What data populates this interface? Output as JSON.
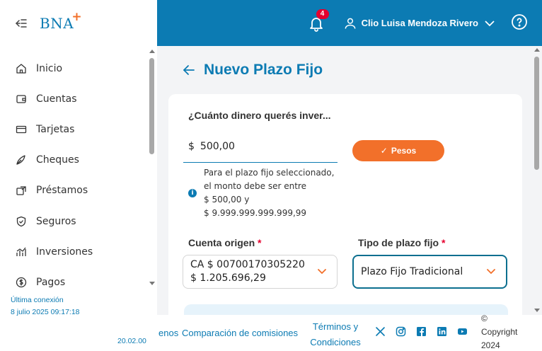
{
  "header": {
    "notifications_count": "4",
    "user_name": "Clio Luisa Mendoza Rivero"
  },
  "sidebar": {
    "logo_text": "BNA",
    "logo_plus": "+",
    "items": [
      {
        "label": "Inicio",
        "icon": "home-icon"
      },
      {
        "label": "Cuentas",
        "icon": "wallet-icon"
      },
      {
        "label": "Tarjetas",
        "icon": "credit-card-icon"
      },
      {
        "label": "Cheques",
        "icon": "pen-icon"
      },
      {
        "label": "Préstamos",
        "icon": "loan-icon"
      },
      {
        "label": "Seguros",
        "icon": "shield-icon"
      },
      {
        "label": "Inversiones",
        "icon": "chart-icon"
      },
      {
        "label": "Pagos",
        "icon": "dollar-icon"
      }
    ],
    "last_connection_label": "Última conexión",
    "last_connection_value": "8 julio 2025 09:17:18",
    "version": "20.02.00"
  },
  "page": {
    "title": "Nuevo Plazo Fijo",
    "question": "¿Cuánto dinero querés inver...",
    "amount_currency_symbol": "$",
    "amount_value": "500,00",
    "currency_button": "Pesos",
    "hint_lines": [
      "Para el plazo fijo seleccionado,",
      "el monto debe ser entre",
      "$ 500,00 y",
      "$ 9.999.999.999.999,99"
    ],
    "origin_label": "Cuenta origen",
    "origin_account": "CA $ 00700170305220",
    "origin_balance": "$ 1.205.696,29",
    "type_label": "Tipo de plazo fijo",
    "type_value": "Plazo Fijo Tradicional",
    "required_mark": "*"
  },
  "footer": {
    "partial_link": "enos",
    "comparison_link": "Comparación de comisiones",
    "terms_line1": "Términos y",
    "terms_line2": "Condiciones",
    "social": [
      "x-icon",
      "instagram-icon",
      "facebook-icon",
      "linkedin-icon",
      "youtube-icon"
    ],
    "copyright_symbol": "©",
    "copyright_text": "Copyright",
    "copyright_year": "2024"
  },
  "colors": {
    "brand_blue": "#0c7bb3",
    "accent_orange": "#f2702a",
    "badge_red": "#e6002e"
  }
}
